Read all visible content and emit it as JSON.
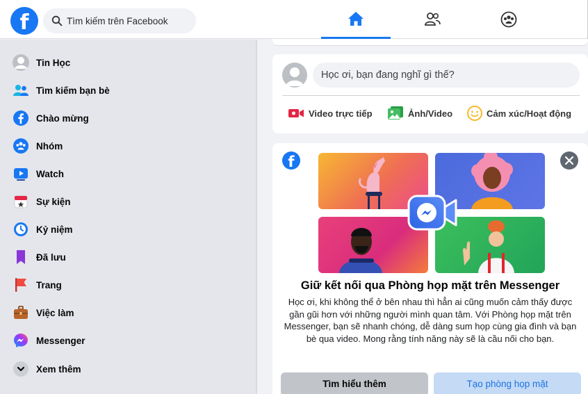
{
  "header": {
    "logo_letter": "f",
    "search_placeholder": "Tìm kiếm trên Facebook",
    "tabs": [
      {
        "name": "home",
        "icon": "home-icon",
        "active": true
      },
      {
        "name": "friends",
        "icon": "friends-icon",
        "active": false
      },
      {
        "name": "groups",
        "icon": "groups-icon",
        "active": false
      }
    ]
  },
  "sidebar": {
    "items": [
      {
        "label": "Tin Học",
        "icon": "profile-avatar-icon"
      },
      {
        "label": "Tìm kiếm bạn bè",
        "icon": "find-friends-icon"
      },
      {
        "label": "Chào mừng",
        "icon": "facebook-icon"
      },
      {
        "label": "Nhóm",
        "icon": "groups-icon"
      },
      {
        "label": "Watch",
        "icon": "watch-icon"
      },
      {
        "label": "Sự kiện",
        "icon": "calendar-icon"
      },
      {
        "label": "Kỷ niệm",
        "icon": "memories-clock-icon"
      },
      {
        "label": "Đã lưu",
        "icon": "bookmark-icon"
      },
      {
        "label": "Trang",
        "icon": "flag-icon"
      },
      {
        "label": "Việc làm",
        "icon": "briefcase-icon"
      },
      {
        "label": "Messenger",
        "icon": "messenger-icon"
      },
      {
        "label": "Xem thêm",
        "icon": "chevron-down-icon"
      }
    ]
  },
  "composer": {
    "prompt": "Học ơi, bạn đang nghĩ gì thế?",
    "actions": {
      "live": "Video trực tiếp",
      "photo": "Ảnh/Video",
      "feeling": "Cảm xúc/Hoạt động"
    }
  },
  "promo": {
    "logo_letter": "f",
    "heading": "Giữ kết nối qua Phòng họp mặt trên Messenger",
    "body": "Học ơi, khi không thể ở bên nhau thì hẳn ai cũng muốn cảm thấy được gần gũi hơn với những người mình quan tâm. Với Phòng họp mặt trên Messenger, bạn sẽ nhanh chóng, dễ dàng sum họp cùng gia đình và bạn bè qua video. Mong rằng tính năng này sẽ là cầu nối cho bạn.",
    "learn_more": "Tìm hiểu thêm",
    "create_room": "Tạo phòng họp mặt"
  },
  "colors": {
    "brand": "#1877f2",
    "sidebar_bg": "#e4e6eb",
    "feed_bg": "#f0f2f5",
    "live_red": "#e42645",
    "photo_green": "#45bd62",
    "feeling_yellow": "#f7b928"
  }
}
